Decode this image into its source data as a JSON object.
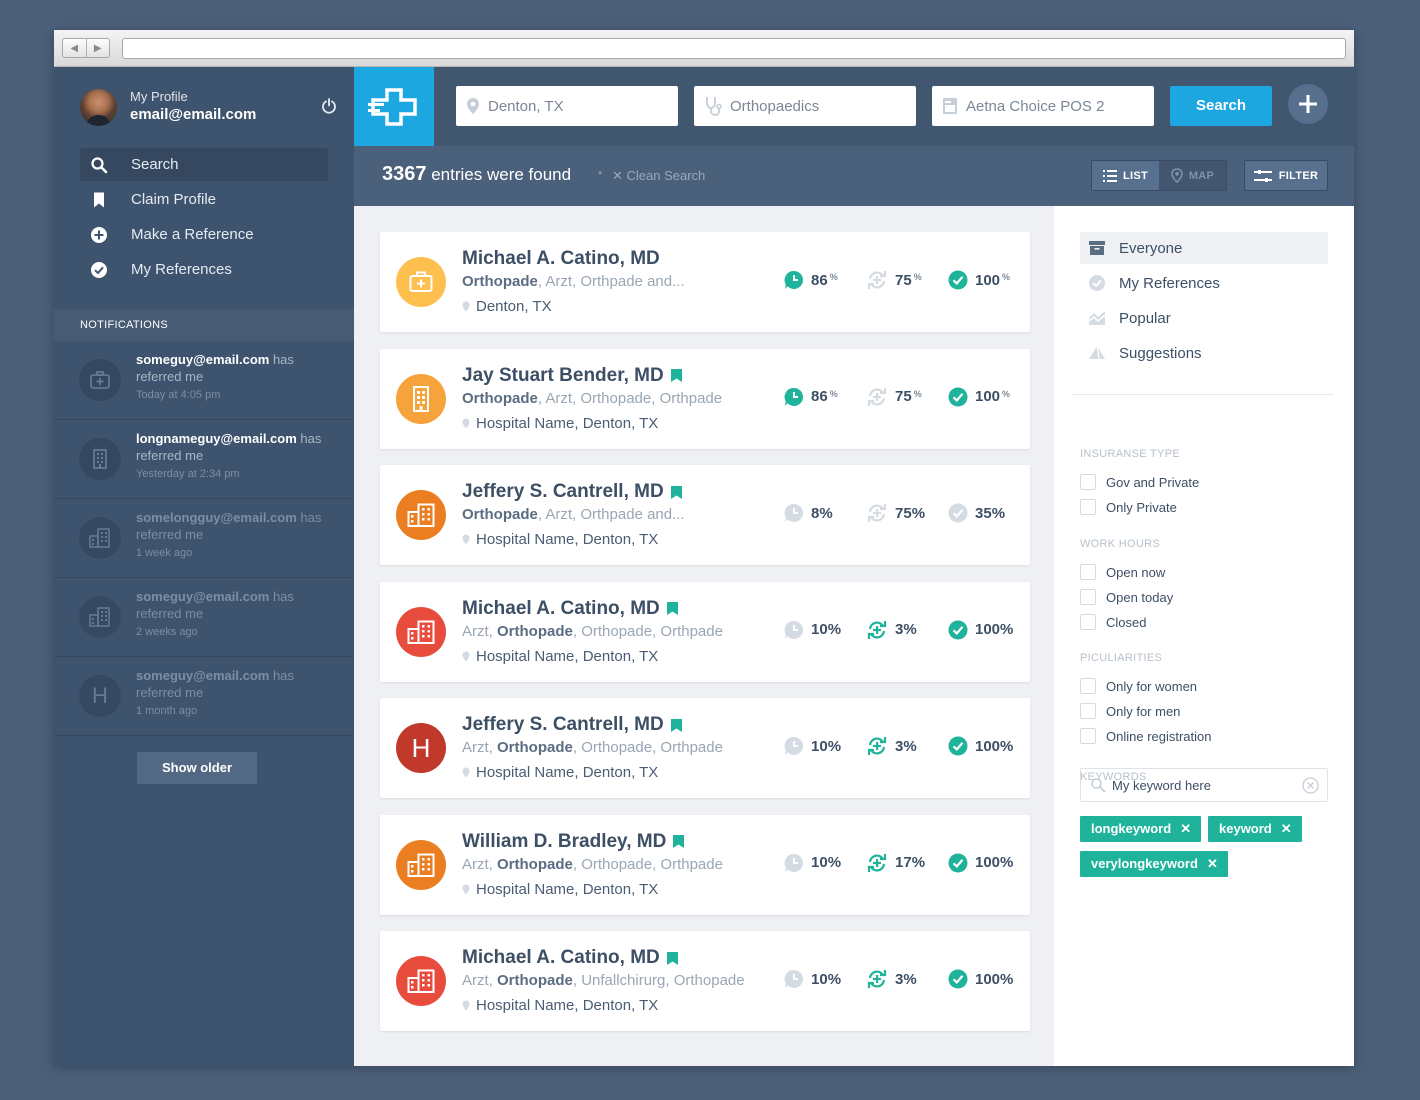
{
  "browser": {
    "back": "◀",
    "forward": "▶"
  },
  "profile": {
    "label": "My Profile",
    "email": "email@email.com"
  },
  "menu": [
    {
      "label": "Search",
      "icon": "search-icon",
      "active": true
    },
    {
      "label": "Claim Profile",
      "icon": "bookmark-icon"
    },
    {
      "label": "Make a Reference",
      "icon": "plus-circle-icon"
    },
    {
      "label": "My References",
      "icon": "check-circle-icon"
    }
  ],
  "notifications": {
    "header": "NOTIFICATIONS",
    "items": [
      {
        "user": "someguy@email.com",
        "text": " has referred me",
        "time": "Today at 4:05 pm",
        "icon": "medical-case-icon"
      },
      {
        "user": "longnameguy@email.com",
        "text": " has referred me",
        "time": "Yesterday at 2:34 pm",
        "icon": "building-icon"
      },
      {
        "user": "somelongguy@email.com",
        "text": " has referred me",
        "time": "1 week ago",
        "icon": "buildings-icon"
      },
      {
        "user": "someguy@email.com",
        "text": " has referred me",
        "time": "2 weeks ago",
        "icon": "buildings-icon"
      },
      {
        "user": "someguy@email.com",
        "text": " has referred me",
        "time": "1 month ago",
        "icon": "hospital-h-icon",
        "letter": "H"
      }
    ],
    "show_older": "Show older"
  },
  "search": {
    "location": "Denton, TX",
    "specialty": "Orthopaedics",
    "insurance": "Aetna Choice POS 2",
    "button": "Search"
  },
  "results_bar": {
    "count": "3367",
    "count_text": " entries were found",
    "separator": "•",
    "clean": "✕  Clean Search",
    "list": "LIST",
    "map": "MAP",
    "filter": "FILTER"
  },
  "colors": {
    "accent_blue": "#1ca7e1",
    "teal": "#1fb39b",
    "yellow": "#fdc04e",
    "orange_light": "#f7a33c",
    "orange": "#ea7e21",
    "red": "#e84c3d",
    "red_dark": "#c0392b"
  },
  "results": [
    {
      "name": "Michael A. Catino, MD",
      "bookmark": false,
      "spec_bold": "Orthopade",
      "spec_rest": ", Arzt, Orthpade and...",
      "spec_lead": "",
      "location": "Denton, TX",
      "avatar": "medical-case-icon",
      "color": "#fdc04e",
      "chat": "86",
      "ref": "75",
      "check": "100",
      "pct_small": true,
      "chat_on": true,
      "ref_on": false,
      "check_on": true
    },
    {
      "name": "Jay Stuart Bender, MD",
      "bookmark": true,
      "spec_bold": "Orthopade",
      "spec_rest": ", Arzt, Orthopade, Orthpade",
      "spec_lead": "",
      "location": "Hospital Name, Denton, TX",
      "avatar": "building-icon",
      "color": "#f7a33c",
      "chat": "86",
      "ref": "75",
      "check": "100",
      "pct_small": true,
      "chat_on": true,
      "ref_on": false,
      "check_on": true
    },
    {
      "name": "Jeffery S. Cantrell, MD",
      "bookmark": true,
      "spec_bold": "Orthopade",
      "spec_rest": ", Arzt, Orthpade and...",
      "spec_lead": "",
      "location": "Hospital Name, Denton, TX",
      "avatar": "buildings-icon",
      "color": "#ea7e21",
      "chat": "8",
      "ref": "75",
      "check": "35",
      "pct_small": false,
      "chat_on": false,
      "ref_on": false,
      "check_on": false
    },
    {
      "name": "Michael A. Catino, MD",
      "bookmark": true,
      "spec_lead": "Arzt, ",
      "spec_bold": "Orthopade",
      "spec_rest": ", Orthopade, Orthpade",
      "location": "Hospital Name, Denton, TX",
      "avatar": "buildings-icon",
      "color": "#e84c3d",
      "chat": "10",
      "ref": "3",
      "check": "100",
      "pct_small": false,
      "chat_on": false,
      "ref_on": true,
      "check_on": true
    },
    {
      "name": "Jeffery S. Cantrell, MD",
      "bookmark": true,
      "spec_lead": "Arzt, ",
      "spec_bold": "Orthopade",
      "spec_rest": ", Orthopade, Orthpade",
      "location": "Hospital Name, Denton, TX",
      "avatar": "hospital-h-icon",
      "letter": "H",
      "color": "#c0392b",
      "chat": "10",
      "ref": "3",
      "check": "100",
      "pct_small": false,
      "chat_on": false,
      "ref_on": true,
      "check_on": true
    },
    {
      "name": "William D. Bradley, MD",
      "bookmark": true,
      "spec_lead": "Arzt, ",
      "spec_bold": "Orthopade",
      "spec_rest": ", Orthopade, Orthpade",
      "location": "Hospital Name, Denton, TX",
      "avatar": "buildings-icon",
      "color": "#ea7e21",
      "chat": "10",
      "ref": "17",
      "check": "100",
      "pct_small": false,
      "chat_on": false,
      "ref_on": true,
      "check_on": true
    },
    {
      "name": "Michael A. Catino, MD",
      "bookmark": true,
      "spec_lead": "Arzt, ",
      "spec_bold": "Orthopade",
      "spec_rest": ", Unfallchirurg, Orthopade",
      "location": "Hospital Name, Denton, TX",
      "avatar": "buildings-icon",
      "color": "#e84c3d",
      "chat": "10",
      "ref": "3",
      "check": "100",
      "pct_small": false,
      "chat_on": false,
      "ref_on": true,
      "check_on": true
    }
  ],
  "filters": {
    "views": [
      {
        "label": "Everyone",
        "icon": "archive-icon",
        "active": true
      },
      {
        "label": "My References",
        "icon": "check-circle-icon"
      },
      {
        "label": "Popular",
        "icon": "trend-icon"
      },
      {
        "label": "Suggestions",
        "icon": "pyramid-icon"
      }
    ],
    "insurance_title": "INSURANSE TYPE",
    "insurance": [
      "Gov and Private",
      "Only Private"
    ],
    "hours_title": "WORK HOURS",
    "hours": [
      "Open now",
      "Open today",
      "Closed"
    ],
    "pec_title": "PICULIARITIES",
    "pec": [
      "Only for women",
      "Only for men",
      "Online registration"
    ],
    "keywords_title": "KEYWORDS",
    "keyword_value": "My keyword here",
    "tags": [
      "longkeyword",
      "keyword",
      "verylongkeyword"
    ]
  }
}
